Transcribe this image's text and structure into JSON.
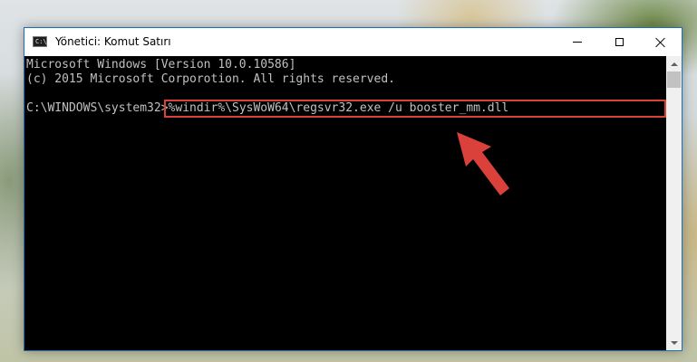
{
  "window": {
    "title": "Yönetici: Komut Satırı",
    "icon_label": "C:\\",
    "controls": {
      "minimize": "minimize-icon",
      "maximize": "maximize-icon",
      "close": "close-icon"
    }
  },
  "console": {
    "lines": [
      "Microsoft Windows [Version 10.0.10586]",
      "(c) 2015 Microsoft Corporotion. All rights reserved.",
      ""
    ],
    "prompt": "C:\\WINDOWS\\system32>",
    "command": "%windir%\\SysWoW64\\regsvr32.exe /u booster_mm.dll"
  },
  "colors": {
    "console_bg": "#000000",
    "console_text": "#c0c0c0",
    "highlight": "#d9413a",
    "window_border": "#1b6fb3"
  },
  "annotation": {
    "icon": "arrow-pointer-icon"
  }
}
